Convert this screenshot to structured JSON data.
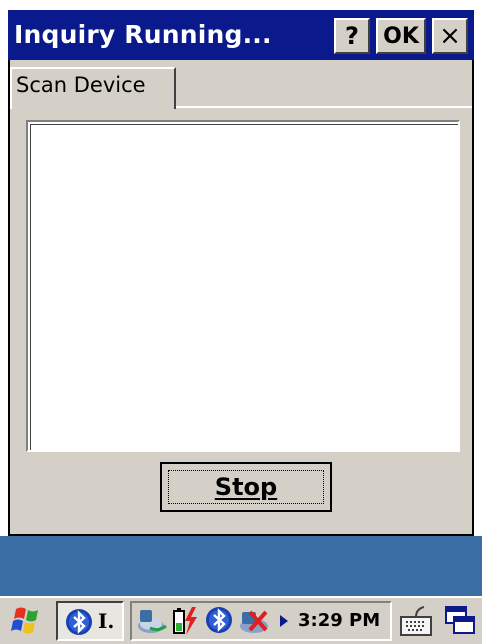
{
  "window": {
    "title": "Inquiry Running...",
    "help_label": "?",
    "ok_label": "OK",
    "close_label": "×"
  },
  "tabs": [
    {
      "label": "Scan Device",
      "selected": true
    }
  ],
  "device_list": {
    "items": []
  },
  "stop_button": {
    "label": "Stop"
  },
  "taskbar": {
    "start_icon": "windows-flag-icon",
    "task_button_label": "I.",
    "task_button_icon": "bluetooth-icon",
    "tray_icons": [
      "network-connection-icon",
      "battery-power-icon",
      "bluetooth-icon",
      "bluetooth-off-icon",
      "tray-expand-arrow-icon"
    ],
    "clock": "3:29 PM",
    "keyboard_icon": "keyboard-icon",
    "desktop_icon": "show-desktop-icon"
  },
  "colors": {
    "title_bar": "#0a1a8c",
    "window_face": "#d4d0c8",
    "desktop": "#3a6ea5"
  }
}
